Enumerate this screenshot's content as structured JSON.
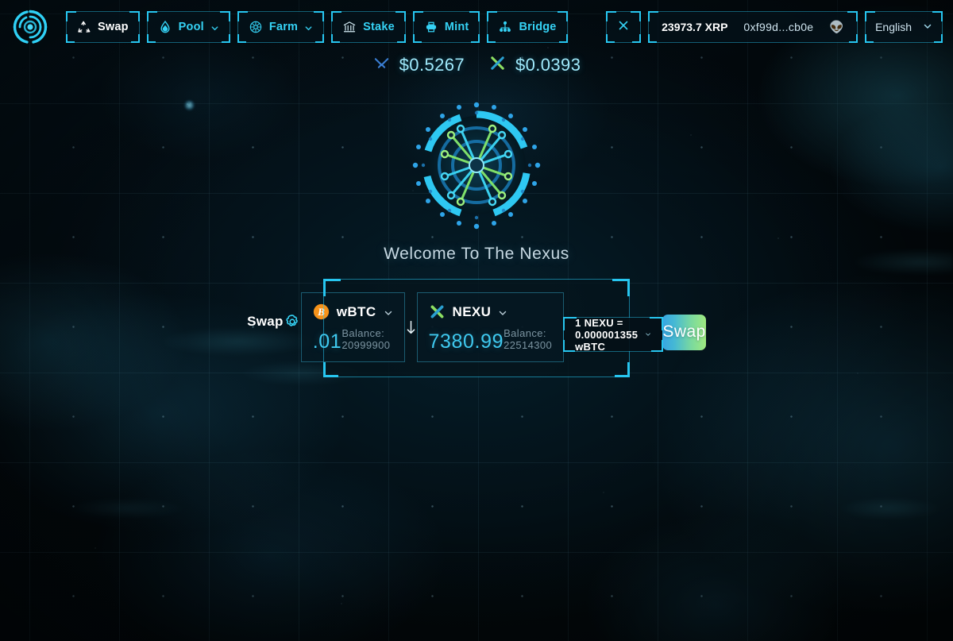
{
  "app": {
    "logo_icon": "nexus-rings-logo",
    "hero_logo_icon": "nexus-circular-emblem",
    "hero_title": "Welcome To The Nexus"
  },
  "nav": {
    "items": [
      {
        "label": "Swap",
        "icon": "recycle-swap-icon",
        "active": true,
        "has_chevron": false
      },
      {
        "label": "Pool",
        "icon": "water-drop-icon",
        "active": false,
        "has_chevron": true
      },
      {
        "label": "Farm",
        "icon": "flower-gear-icon",
        "active": false,
        "has_chevron": true
      },
      {
        "label": "Stake",
        "icon": "bank-icon",
        "active": false,
        "has_chevron": false
      },
      {
        "label": "Mint",
        "icon": "stamp-printer-icon",
        "active": false,
        "has_chevron": false
      },
      {
        "label": "Bridge",
        "icon": "network-nodes-icon",
        "active": false,
        "has_chevron": false
      }
    ]
  },
  "topright": {
    "close_icon": "close-x-icon",
    "wallet": {
      "balance": "23973.7 XRP",
      "address": "0xf99d...cb0e",
      "avatar_icon": "alien-avatar-icon",
      "avatar_glyph": "👽"
    },
    "language": {
      "value": "English",
      "chevron_icon": "chevron-down-icon"
    }
  },
  "ticker": {
    "items": [
      {
        "icon": "xrp-x-icon",
        "price": "$0.5267"
      },
      {
        "icon": "nexu-x-icon",
        "price": "$0.0393"
      }
    ]
  },
  "swap_card": {
    "title": "Swap",
    "settings_icon": "gear-icon",
    "from": {
      "token": "wBTC",
      "token_icon": "bitcoin-icon",
      "chevron_icon": "chevron-down-icon",
      "amount": ".01",
      "balance": "Balance: 20999900"
    },
    "direction_icon": "arrow-down-icon",
    "to": {
      "token": "NEXU",
      "token_icon": "nexu-x-icon",
      "chevron_icon": "chevron-down-icon",
      "amount": "7380.99",
      "balance": "Balance: 22514300"
    },
    "rate": {
      "text": "1 NEXU = 0.000001355 wBTC",
      "chevron_icon": "chevron-down-icon"
    },
    "submit_label": "Swap"
  },
  "colors": {
    "accent_cyan": "#27c6f0",
    "amount_blue": "#3fc9ef",
    "bitcoin_orange": "#f7931a",
    "swap_gradient_start": "#38a5e2",
    "swap_gradient_end": "#9fe97f",
    "background": "#02080b"
  }
}
